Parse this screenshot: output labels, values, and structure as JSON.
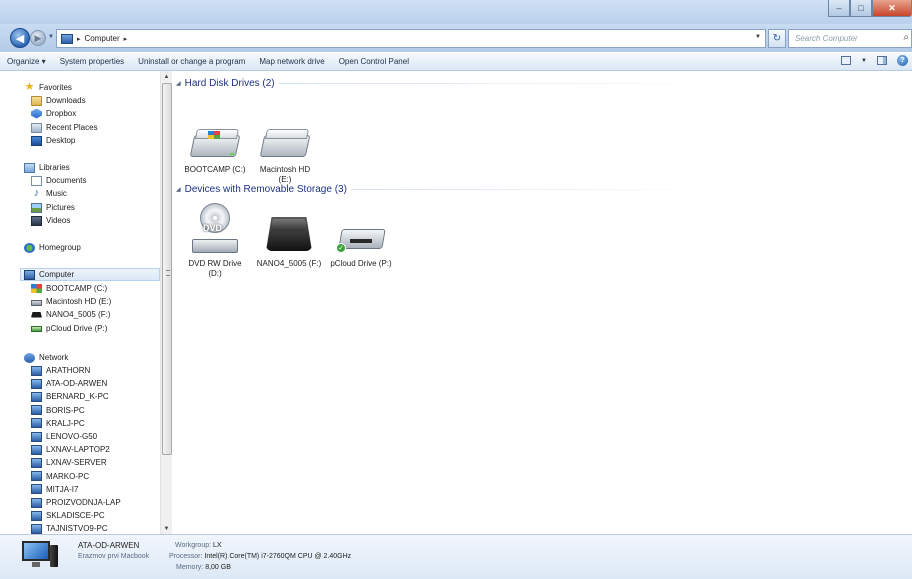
{
  "address": {
    "path_segment": "Computer",
    "search_placeholder": "Search Computer"
  },
  "toolbar": {
    "organize": "Organize ▾",
    "system_properties": "System properties",
    "uninstall": "Uninstall or change a program",
    "map_drive": "Map network drive",
    "open_control_panel": "Open Control Panel"
  },
  "nav": {
    "favorites": "Favorites",
    "downloads": "Downloads",
    "dropbox": "Dropbox",
    "recent_places": "Recent Places",
    "desktop": "Desktop",
    "libraries": "Libraries",
    "documents": "Documents",
    "music": "Music",
    "pictures": "Pictures",
    "videos": "Videos",
    "homegroup": "Homegroup",
    "computer": "Computer",
    "bootcamp": "BOOTCAMP (C:)",
    "macintosh": "Macintosh HD (E:)",
    "nano": "NANO4_5005 (F:)",
    "pcloud": "pCloud Drive (P:)",
    "network": "Network",
    "network_pcs": [
      "ARATHORN",
      "ATA-OD-ARWEN",
      "BERNARD_K-PC",
      "BORIS-PC",
      "KRALJ-PC",
      "LENOVO-G50",
      "LXNAV-LAPTOP2",
      "LXNAV-SERVER",
      "MARKO-PC",
      "MITJA-I7",
      "PROIZVODNJA-LAP",
      "SKLADISCE-PC",
      "TAJNISTVO9-PC"
    ]
  },
  "content": {
    "hdd_group": "Hard Disk Drives (2)",
    "removable_group": "Devices with Removable Storage (3)",
    "bootcamp_tile": "BOOTCAMP (C:)",
    "macintosh_tile_line1": "Macintosh HD",
    "macintosh_tile_line2": "(E:)",
    "dvd_tile_line1": "DVD RW Drive",
    "dvd_tile_line2": "(D:)",
    "dvd_disc_label": "DVD",
    "nano_tile": "NANO4_5005 (F:)",
    "pcloud_tile": "pCloud Drive (P:)"
  },
  "details": {
    "name": "ATA-OD-ARWEN",
    "description": "Erazmov prvi Macbook",
    "workgroup_label": "Workgroup:",
    "workgroup_value": "LX",
    "processor_label": "Processor:",
    "processor_value": "Intel(R) Core(TM) i7-2760QM CPU @ 2.40GHz",
    "memory_label": "Memory:",
    "memory_value": "8,00 GB"
  }
}
